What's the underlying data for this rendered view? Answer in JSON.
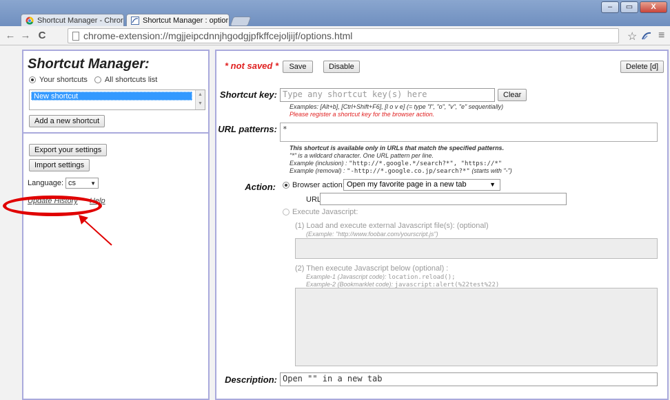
{
  "browser": {
    "tabs": [
      {
        "title": "Shortcut Manager - Chror"
      },
      {
        "title": "Shortcut Manager : optior"
      }
    ],
    "url": "chrome-extension://mgjjeipcdnnjhgodgjpfkffcejoljijf/options.html",
    "back_glyph": "←",
    "forward_glyph": "→",
    "reload_glyph": "C",
    "star_glyph": "☆",
    "menu_glyph": "≡",
    "window_controls": {
      "minimize": "–",
      "maximize": "▭",
      "close": "X"
    }
  },
  "left": {
    "app_title": "Shortcut Manager:",
    "radio_your": "Your shortcuts",
    "radio_all": "All shortcuts list",
    "selected_shortcut": "New shortcut",
    "add_button": "Add a new shortcut",
    "export_button": "Export your settings",
    "import_button": "Import settings",
    "language_label": "Language:",
    "language_value": "cs",
    "update_history_link": "Update History",
    "help_link": "Help"
  },
  "right": {
    "not_saved": "* not saved *",
    "save_button": "Save",
    "disable_button": "Disable",
    "delete_button": "Delete [d]",
    "shortcut_key_label": "Shortcut key:",
    "shortcut_key_placeholder": "Type any shortcut key(s) here",
    "clear_button": "Clear",
    "shortcut_examples": "Examples: [Alt+b], [Ctrl+Shift+F6], [l o v e] (= type \"l\", \"o\", \"v\", \"e\" sequentially)",
    "shortcut_error": "Please register a shortcut key for the browser action.",
    "url_patterns_label": "URL patterns:",
    "url_patterns_value": "*",
    "url_help_1": "This shortcut is available only in URLs that match the specified patterns.",
    "url_help_2": "\"*\" is a wildcard character. One URL pattern per line.",
    "url_help_3_prefix": "Example (inclusion) : ",
    "url_help_3_code": "\"http://*.google.*/search?*\", \"https://*\"",
    "url_help_4_prefix": "Example (removal) : ",
    "url_help_4_code": "\"-http://*.google.co.jp/search?*\"",
    "url_help_4_suffix": " (starts with \"-\")",
    "action_label": "Action:",
    "browser_action_label": "Browser action:",
    "browser_action_value": "Open my favorite page in a new tab",
    "url_label": "URL:",
    "url_value": "",
    "execute_js_label": "Execute Javascript:",
    "js_step1": "(1) Load and execute external Javascript file(s): (optional)",
    "js_step1_example": "(Example: \"http://www.foobar.com/yourscript.js\")",
    "js_step2": "(2) Then execute Javascript below (optional) :",
    "js_example1_prefix": "Example-1 (Javascript code): ",
    "js_example1_code": "location.reload();",
    "js_example2_prefix": "Example-2 (Bookmarklet code): ",
    "js_example2_code": "javascript:alert(%22test%22)",
    "description_label": "Description:",
    "description_value": "Open \"\" in a new tab"
  },
  "colors": {
    "panel_border": "#a9a9dc",
    "annotation_red": "#e00000",
    "error_red": "#e02020",
    "selection_blue": "#3399ff"
  }
}
